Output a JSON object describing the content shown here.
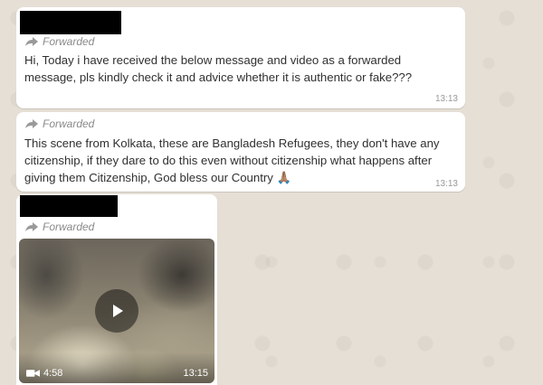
{
  "messages": [
    {
      "forwarded_label": "Forwarded",
      "text": "Hi,  Today i have received the below message and video as a forwarded message,  pls kindly check it and advice whether it is authentic or fake???",
      "time": "13:13"
    },
    {
      "forwarded_label": "Forwarded",
      "text": "This scene from Kolkata,  these are Bangladesh Refugees,  they don't have any citizenship, if they dare to do this even without citizenship what happens after giving them Citizenship,  God bless our Country 🙏🏽",
      "time": "13:13"
    },
    {
      "forwarded_label": "Forwarded",
      "video": {
        "duration": "4:58",
        "time": "13:15",
        "play_icon": "play-icon",
        "camera_icon": "video-camera-icon"
      }
    }
  ],
  "colors": {
    "bubble": "#ffffff",
    "background": "#e6dfd6",
    "meta": "#9a9a9a"
  }
}
